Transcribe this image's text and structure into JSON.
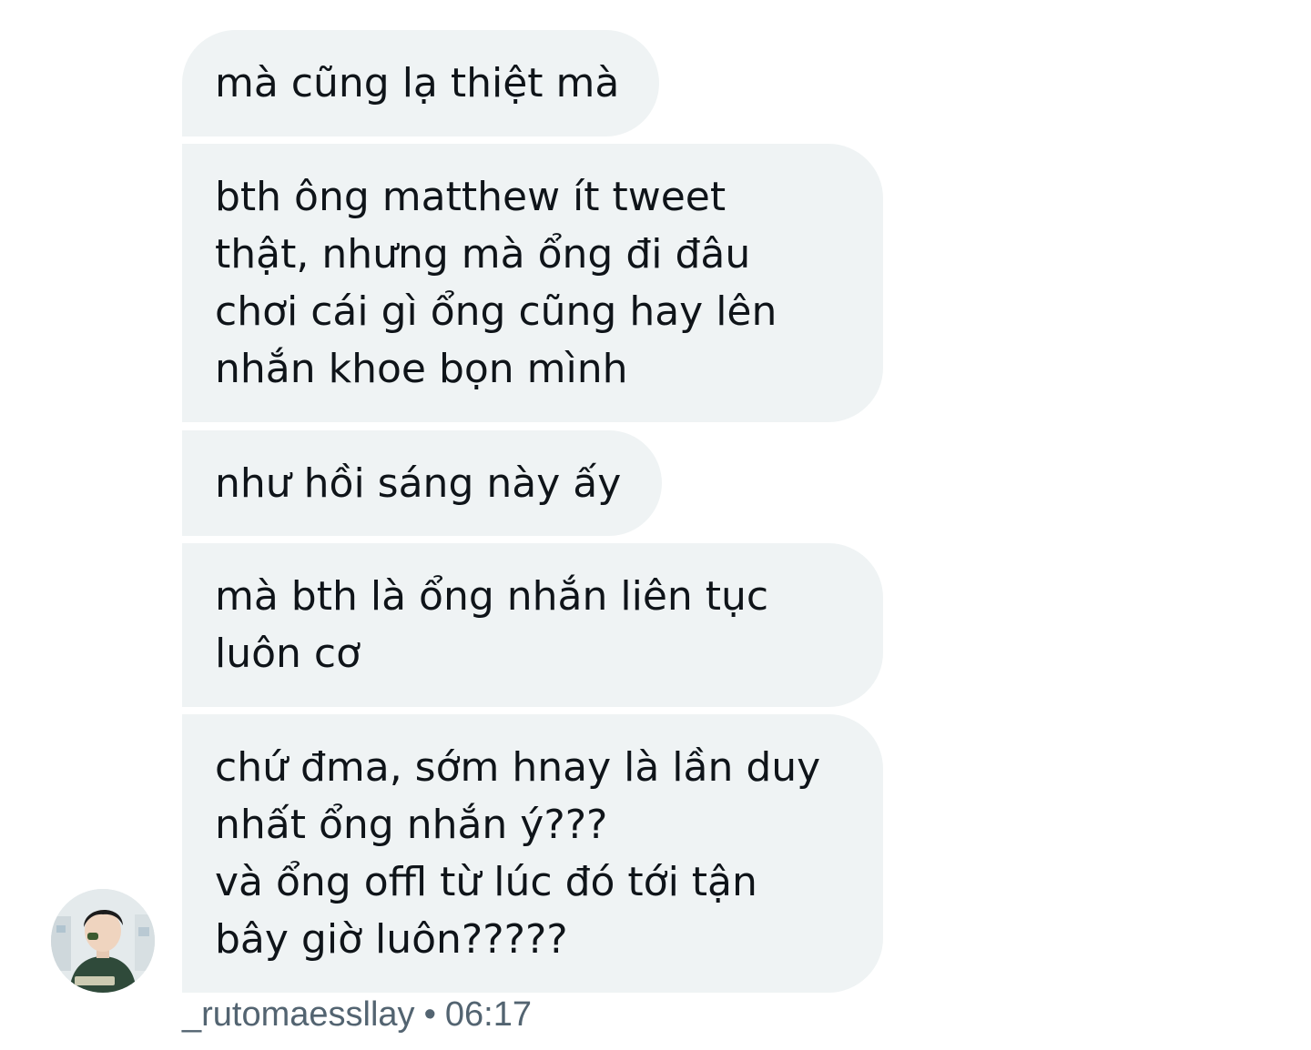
{
  "messages": [
    {
      "text": "mà cũng lạ thiệt mà"
    },
    {
      "text": "bth ông matthew ít tweet\nthật, nhưng mà ổng đi đâu\nchơi cái gì ổng cũng hay lên\nnhắn khoe bọn mình"
    },
    {
      "text": "như hồi sáng này ấy"
    },
    {
      "text": "mà bth là ổng nhắn liên tục\nluôn cơ"
    },
    {
      "text": "chứ đma, sớm hnay là lần duy\nnhất ổng nhắn ý???\nvà ổng offl từ lúc đó tới tận\nbây giờ luôn?????"
    }
  ],
  "sender": {
    "username": "_rutomaessllay",
    "separator": "•",
    "time": "06:17",
    "avatar_icon": "user-avatar-photo"
  },
  "colors": {
    "bubble_bg": "#eff3f4",
    "text": "#0f1419",
    "meta_text": "#536471"
  }
}
